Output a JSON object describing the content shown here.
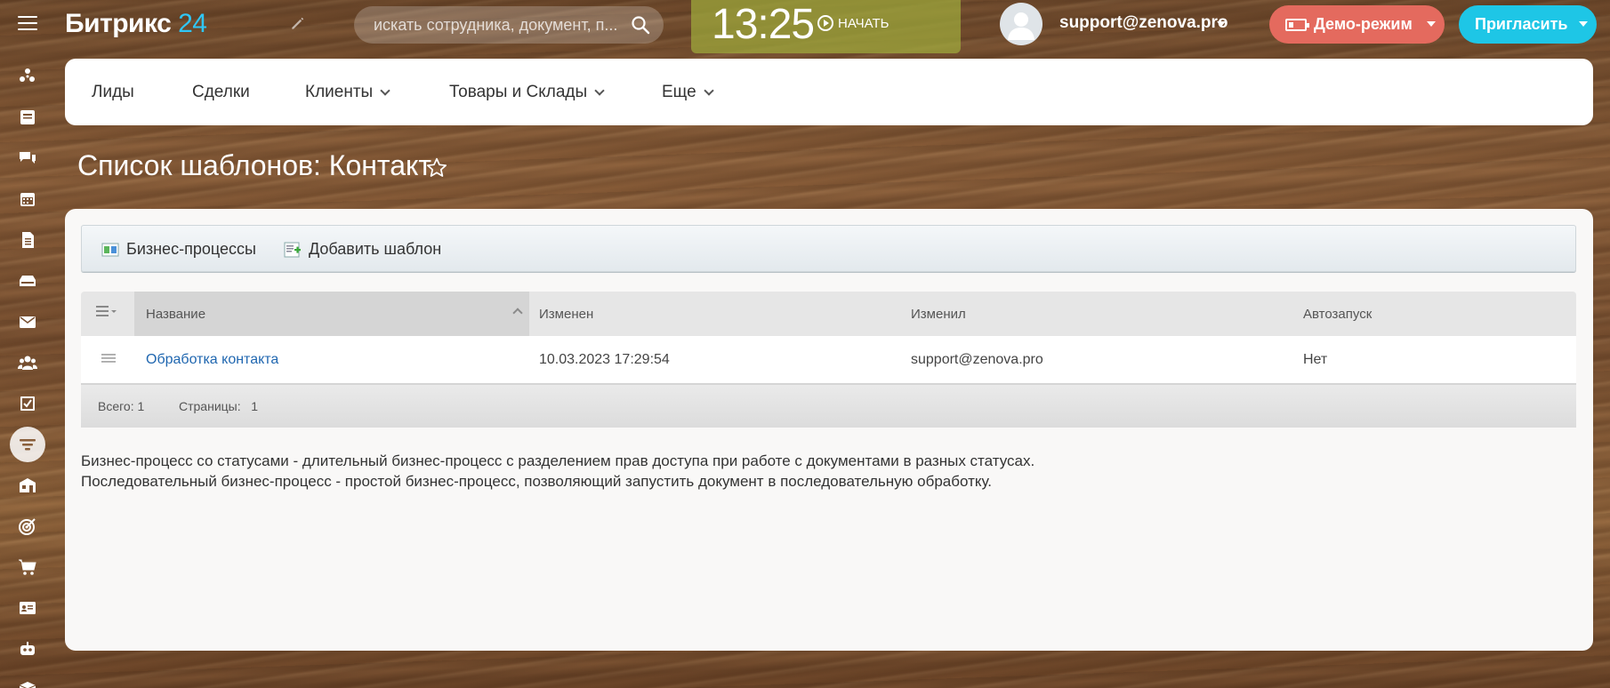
{
  "topbar": {
    "logo_text": "Битрикс",
    "logo_num": "24",
    "search_placeholder": "искать сотрудника, документ, п...",
    "clock": "13:25",
    "start_label": "НАЧАТЬ",
    "user_email": "support@zenova.pro",
    "demo_label": "Демо-режим",
    "invite_label": "Пригласить"
  },
  "nav": {
    "items": [
      {
        "label": "Лиды",
        "dropdown": false
      },
      {
        "label": "Сделки",
        "dropdown": false
      },
      {
        "label": "Клиенты",
        "dropdown": true
      },
      {
        "label": "Товары и Склады",
        "dropdown": true
      },
      {
        "label": "Еще",
        "dropdown": true
      }
    ]
  },
  "page": {
    "title": "Список шаблонов: Контакт"
  },
  "toolbar": {
    "bp_label": "Бизнес-процессы",
    "add_label": "Добавить шаблон"
  },
  "grid": {
    "headers": [
      "Название",
      "Изменен",
      "Изменил",
      "Автозапуск"
    ],
    "rows": [
      {
        "name": "Обработка контакта",
        "modified": "10.03.2023 17:29:54",
        "modified_by": "support@zenova.pro",
        "autostart": "Нет"
      }
    ],
    "footer": {
      "total_label": "Всего:",
      "total": "1",
      "pages_label": "Страницы:",
      "pages": "1"
    }
  },
  "description": {
    "line1": "Бизнес-процесс со статусами - длительный бизнес-процесс с разделением прав доступа при работе с документами в разных статусах.",
    "line2": "Последовательный бизнес-процесс - простой бизнес-процесс, позволяющий запустить документ в последовательную обработку."
  },
  "colors": {
    "accent": "#2fc6f6",
    "demo": "#e46a5e",
    "invite": "#1ec6e6",
    "link": "#2067b0",
    "clock_bg": "#a0aa3c"
  },
  "sidebar_icons": [
    "feed-icon",
    "newspaper-icon",
    "chat-icon",
    "calendar-icon",
    "document-icon",
    "drive-icon",
    "mail-icon",
    "group-icon",
    "tasks-icon",
    "crm-filter-icon",
    "shop-icon",
    "target-icon",
    "cart-icon",
    "contact-card-icon",
    "robot-icon",
    "box-icon"
  ]
}
